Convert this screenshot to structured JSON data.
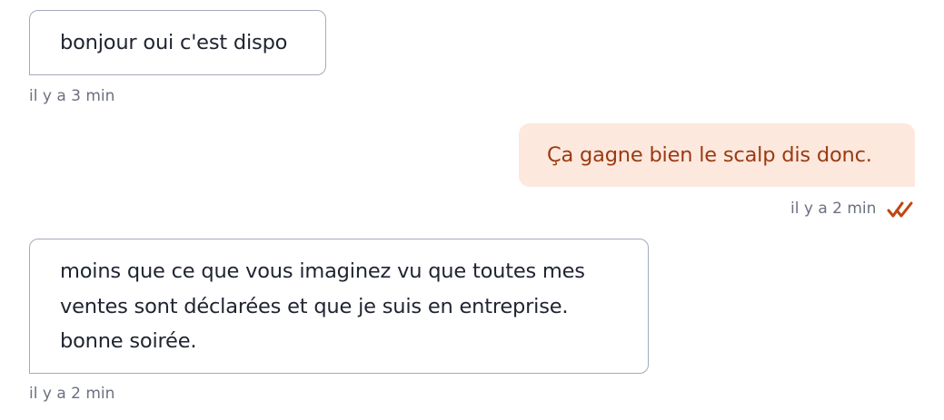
{
  "messages": [
    {
      "direction": "incoming",
      "text": "bonjour oui c'est dispo",
      "time": "il y a 3 min"
    },
    {
      "direction": "outgoing",
      "text": "Ça gagne bien le scalp dis donc.",
      "time": "il y a 2 min",
      "status_icon": "double-check-icon",
      "status": "read"
    },
    {
      "direction": "incoming",
      "text": "moins que ce que vous imaginez vu que toutes mes ventes sont déclarées et que je suis en entreprise. bonne soirée.",
      "time": "il y a 2 min"
    }
  ],
  "colors": {
    "incoming_border": "#a4abbb",
    "incoming_text": "#1f2430",
    "outgoing_bg": "#fde8de",
    "outgoing_text": "#9a3a12",
    "meta_text": "#6b7180",
    "read_ticks": "#c0460f"
  }
}
